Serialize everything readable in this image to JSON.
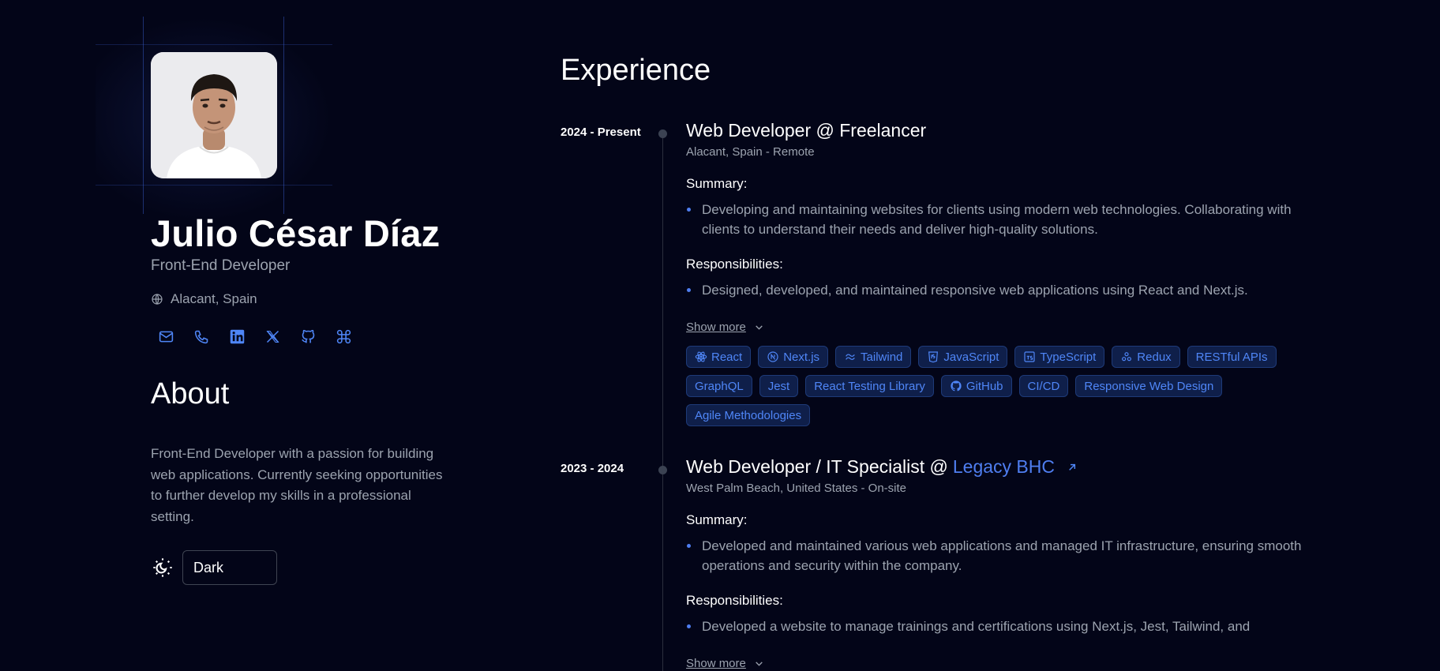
{
  "profile": {
    "name": "Julio César Díaz",
    "role": "Front-End Developer",
    "location": "Alacant, Spain",
    "avatar_alt": "Profile photo"
  },
  "socials": [
    {
      "icon": "mail-icon",
      "label": "Email"
    },
    {
      "icon": "phone-icon",
      "label": "Phone"
    },
    {
      "icon": "linkedin-icon",
      "label": "LinkedIn"
    },
    {
      "icon": "x-icon",
      "label": "X"
    },
    {
      "icon": "github-icon",
      "label": "GitHub"
    },
    {
      "icon": "command-icon",
      "label": "Command"
    }
  ],
  "about": {
    "title": "About",
    "text": "Front-End Developer with a passion for building web applications. Currently seeking opportunities to further develop my skills in a professional setting."
  },
  "theme": {
    "selected": "Dark"
  },
  "experience": {
    "title": "Experience",
    "jobs": [
      {
        "date": "2024 - Present",
        "title": "Web Developer @ Freelancer",
        "company_link": "",
        "location": "Alacant, Spain - Remote",
        "summary_label": "Summary:",
        "summary": "Developing and maintaining websites for clients using modern web technologies. Collaborating with clients to understand their needs and deliver high-quality solutions.",
        "responsibilities_label": "Responsibilities:",
        "responsibilities": "Designed, developed, and maintained responsive web applications using React and Next.js.",
        "show_more": "Show more",
        "tags": [
          "React",
          "Next.js",
          "Tailwind",
          "JavaScript",
          "TypeScript",
          "Redux",
          "RESTful APIs",
          "GraphQL",
          "Jest",
          "React Testing Library",
          "GitHub",
          "CI/CD",
          "Responsive Web Design",
          "Agile Methodologies"
        ]
      },
      {
        "date": "2023 - 2024",
        "title": "Web Developer / IT Specialist @",
        "company_link": "Legacy BHC",
        "location": "West Palm Beach, United States - On-site",
        "summary_label": "Summary:",
        "summary": "Developed and maintained various web applications and managed IT infrastructure, ensuring smooth operations and security within the company.",
        "responsibilities_label": "Responsibilities:",
        "responsibilities": "Developed a website to manage trainings and certifications using Next.js, Jest, Tailwind, and",
        "show_more": "Show more"
      }
    ]
  },
  "colors": {
    "background": "#030518",
    "accent": "#4f7ef0",
    "tag_bg": "#0f1f4a",
    "muted_text": "#9ca3af"
  }
}
